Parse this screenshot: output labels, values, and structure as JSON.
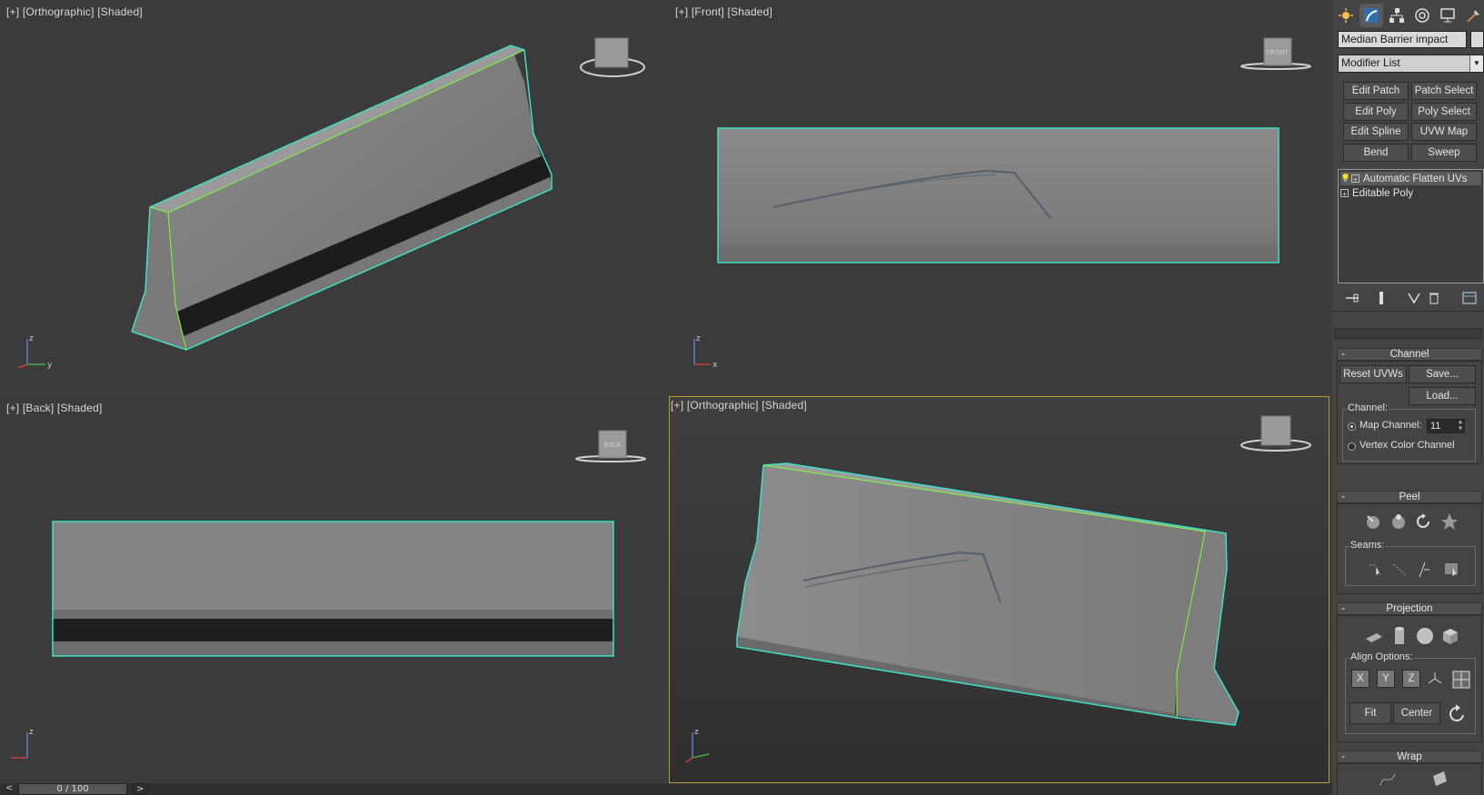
{
  "viewports": [
    {
      "id": "top-left",
      "label": {
        "plus": "[+]",
        "view": "[Orthographic]",
        "shading": "[Shaded]"
      }
    },
    {
      "id": "top-right",
      "label": {
        "plus": "[+]",
        "view": "[Front]",
        "shading": "[Shaded]"
      },
      "navcube_text": "FRONT"
    },
    {
      "id": "bottom-left",
      "label": {
        "plus": "[+]",
        "view": "[Back]",
        "shading": "[Shaded]"
      },
      "navcube_text": "BACK"
    },
    {
      "id": "bottom-right",
      "label": {
        "plus": "[+]",
        "view": "[Orthographic]",
        "shading": "[Shaded]"
      },
      "active": true
    }
  ],
  "axis_labels": {
    "z": "z",
    "y": "y",
    "x": "x"
  },
  "timeline": {
    "position": "0 / 100",
    "prev": "<",
    "next": ">"
  },
  "command_panel": {
    "tabs": [
      "create-icon",
      "modify-icon",
      "hierarchy-icon",
      "motion-icon",
      "display-icon",
      "utilities-icon"
    ],
    "object_name": "Median Barrier impact",
    "modifier_list": "Modifier List",
    "modifier_buttons": [
      [
        "Edit Patch",
        "Patch Select"
      ],
      [
        "Edit Poly",
        "Poly Select"
      ],
      [
        "Edit Spline",
        "UVW Map"
      ],
      [
        "Bend",
        "Sweep"
      ]
    ],
    "stack": [
      {
        "label": "Automatic Flatten UVs",
        "selected": true
      },
      {
        "label": "Editable Poly",
        "selected": false
      }
    ],
    "channel": {
      "title": "Channel",
      "collapse": "-",
      "reset": "Reset UVWs",
      "save": "Save...",
      "load": "Load...",
      "group_label": "Channel:",
      "map_channel_label": "Map Channel:",
      "map_channel_value": "11",
      "vertex_color_label": "Vertex Color Channel",
      "selected": "map"
    },
    "peel": {
      "title": "Peel",
      "collapse": "-",
      "seams_label": "Seams:"
    },
    "projection": {
      "title": "Projection",
      "collapse": "-",
      "align_label": "Align Options:",
      "x": "X",
      "y": "Y",
      "z": "Z",
      "fit": "Fit",
      "center": "Center"
    },
    "wrap": {
      "title": "Wrap",
      "collapse": "-"
    }
  },
  "colors": {
    "selection": "#3fe0c8",
    "edge": "#7cff3a",
    "active_border": "#b89a2e",
    "viewport_bg": "#3b3b3b"
  }
}
